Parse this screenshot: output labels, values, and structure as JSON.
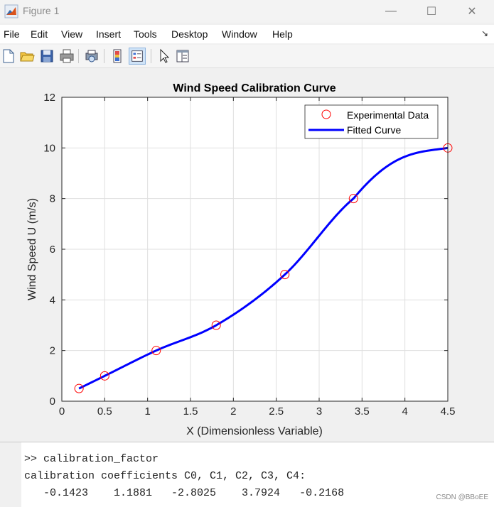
{
  "window": {
    "title": "Figure 1",
    "controls": {
      "minimize": "—",
      "maximize": "☐",
      "close": "✕"
    }
  },
  "menu": {
    "items": [
      "File",
      "Edit",
      "View",
      "Insert",
      "Tools",
      "Desktop",
      "Window",
      "Help"
    ],
    "dock_arrow": "↘"
  },
  "toolbar": {
    "buttons": [
      "new-figure-icon",
      "open-icon",
      "save-icon",
      "print-icon",
      "print-preview-icon",
      "colorbar-icon",
      "legend-icon",
      "pointer-icon",
      "property-inspector-icon"
    ]
  },
  "chart_data": {
    "type": "line",
    "title": "Wind Speed Calibration Curve",
    "xlabel": "X (Dimensionless Variable)",
    "ylabel": "Wind Speed U (m/s)",
    "xlim": [
      0,
      4.5
    ],
    "ylim": [
      0,
      12
    ],
    "xticks": [
      "0",
      "0.5",
      "1",
      "1.5",
      "2",
      "2.5",
      "3",
      "3.5",
      "4",
      "4.5"
    ],
    "yticks": [
      "0",
      "2",
      "4",
      "6",
      "8",
      "10",
      "12"
    ],
    "grid": true,
    "legend": {
      "position": "top-right",
      "entries": [
        "Experimental Data",
        "Fitted Curve"
      ]
    },
    "series": [
      {
        "name": "Experimental Data",
        "kind": "scatter",
        "marker": "circle",
        "color": "#ff0000",
        "x": [
          0.2,
          0.5,
          1.1,
          1.8,
          2.6,
          3.4,
          4.5
        ],
        "y": [
          0.5,
          1.0,
          2.0,
          3.0,
          5.0,
          8.0,
          10.0
        ]
      },
      {
        "name": "Fitted Curve",
        "kind": "line",
        "color": "#0000ff",
        "coefficients": [
          -0.1423,
          1.1881,
          -2.8025,
          3.7924,
          -0.2168
        ],
        "x_range": [
          0.2,
          4.5
        ]
      }
    ]
  },
  "command_window": {
    "lines": [
      ">> calibration_factor",
      "calibration coefficients C0, C1, C2, C3, C4:",
      "   -0.1423    1.1881   -2.8025    3.7924   -0.2168"
    ],
    "watermark": "CSDN @BBoEE"
  }
}
